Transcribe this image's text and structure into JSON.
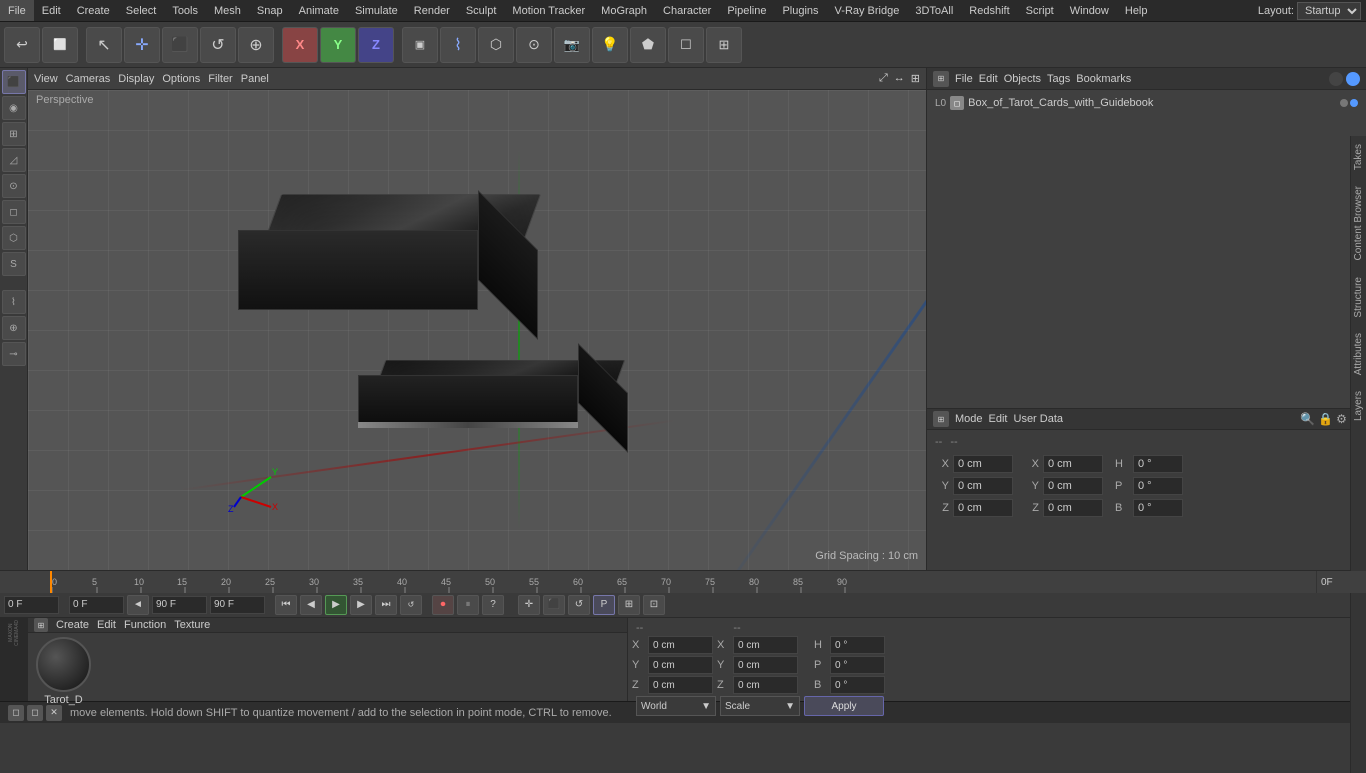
{
  "menubar": {
    "items": [
      "File",
      "Edit",
      "Create",
      "Select",
      "Tools",
      "Mesh",
      "Snap",
      "Animate",
      "Simulate",
      "Render",
      "Sculpt",
      "Motion Tracker",
      "MoGraph",
      "Character",
      "Pipeline",
      "Plugins",
      "V-Ray Bridge",
      "3DToAll",
      "Redshift",
      "Script",
      "Window",
      "Help"
    ],
    "layout_label": "Layout:",
    "layout_value": "Startup"
  },
  "toolbar": {
    "buttons": [
      "↩",
      "◻",
      "↖",
      "✛",
      "⬛",
      "↺",
      "⊕",
      "⯅",
      "⯆",
      "⊞",
      "▷",
      "⬡",
      "⊙",
      "⬟",
      "☐",
      "📷",
      "💡"
    ],
    "axis_buttons": [
      "X",
      "Y",
      "Z"
    ]
  },
  "viewport": {
    "menus": [
      "View",
      "Cameras",
      "Display",
      "Options",
      "Filter",
      "Panel"
    ],
    "label": "Perspective",
    "grid_spacing": "Grid Spacing : 10 cm"
  },
  "object_manager": {
    "menus": [
      "File",
      "Edit",
      "Objects",
      "Tags",
      "Bookmarks"
    ],
    "object_name": "Box_of_Tarot_Cards_with_Guidebook"
  },
  "attributes": {
    "mode_menus": [
      "Mode",
      "Edit",
      "User Data"
    ],
    "coord_label1": "--",
    "coord_label2": "--",
    "x_pos_label": "X",
    "x_pos_value": "0 cm",
    "y_pos_label": "Y",
    "y_pos_value": "0 cm",
    "z_pos_label": "Z",
    "z_pos_value": "0 cm",
    "x_rot_label": "X",
    "x_rot_value": "0 cm",
    "y_rot_label": "Y",
    "y_rot_value": "0 cm",
    "z_rot_label": "Z",
    "z_rot_value": "0 cm",
    "h_label": "H",
    "h_value": "0 °",
    "p_label": "P",
    "p_value": "0 °",
    "b_label": "B",
    "b_value": "0 °"
  },
  "timeline": {
    "ticks": [
      0,
      5,
      10,
      15,
      20,
      25,
      30,
      35,
      40,
      45,
      50,
      55,
      60,
      65,
      70,
      75,
      80,
      85,
      90
    ],
    "current_frame": "0 F",
    "start_frame": "0 F",
    "end_frame_1": "90 F",
    "end_frame_2": "90 F",
    "frame_indicator": "0F"
  },
  "material": {
    "menus": [
      "Create",
      "Edit",
      "Function",
      "Texture"
    ],
    "name": "Tarot_D"
  },
  "coord_panel": {
    "dash1": "--",
    "dash2": "--",
    "x": "0 cm",
    "y": "0 cm",
    "z": "0 cm",
    "x2": "0 cm",
    "y2": "0 cm",
    "z2": "0 cm",
    "world_label": "World",
    "scale_label": "Scale",
    "apply_label": "Apply"
  },
  "status": {
    "text": "move elements. Hold down SHIFT to quantize movement / add to the selection in point mode, CTRL to remove.",
    "icons": [
      "◻",
      "◻",
      "×"
    ]
  },
  "right_vtabs": [
    "Takes",
    "Content Browser",
    "Structure",
    "Attributes",
    "Layers"
  ],
  "anim_ctrl_buttons": [
    "⏮",
    "◀◀",
    "▶",
    "▶▶",
    "⏭",
    "🔴",
    "⏸",
    "?",
    "✛",
    "⬛",
    "↺",
    "🅟",
    "⊞",
    "⊡"
  ]
}
